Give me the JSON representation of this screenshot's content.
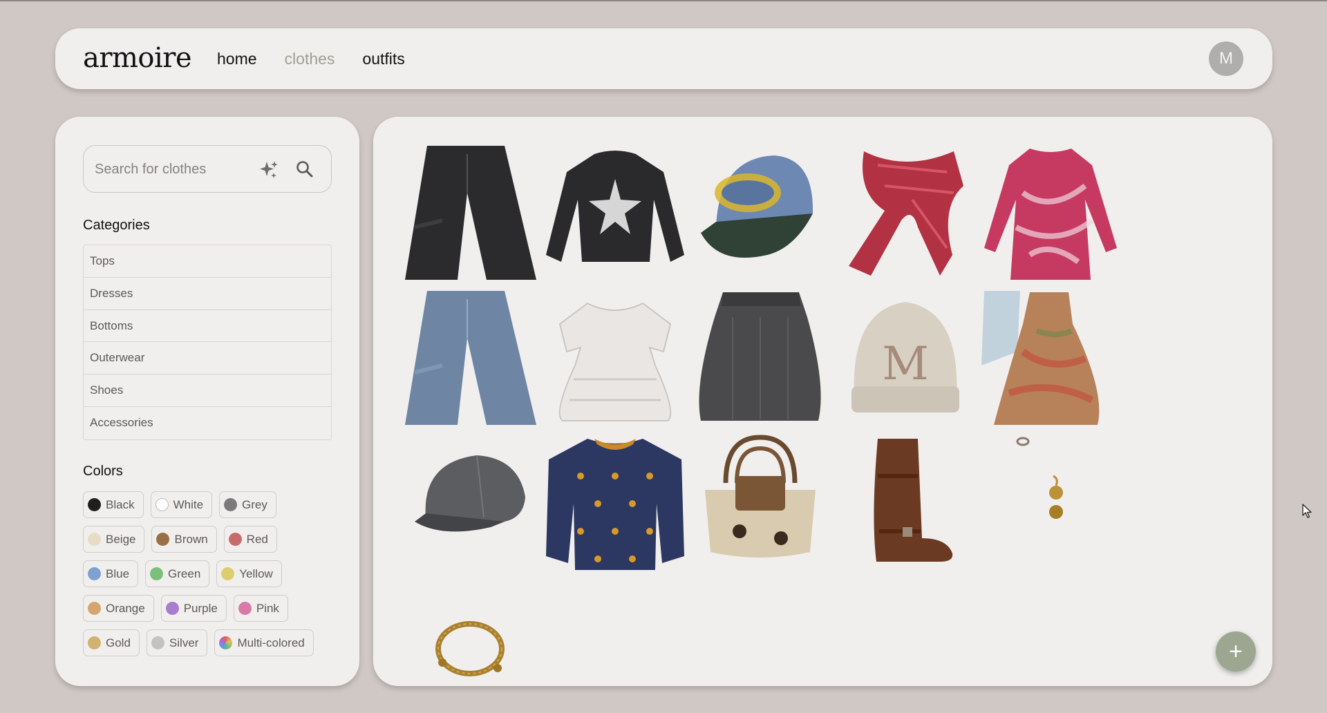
{
  "app": {
    "name": "armoire"
  },
  "nav": {
    "items": [
      "home",
      "clothes",
      "outfits"
    ],
    "active": "clothes"
  },
  "user": {
    "avatar_initial": "M"
  },
  "search": {
    "placeholder": "Search for clothes",
    "value": ""
  },
  "sidebar": {
    "categories_title": "Categories",
    "categories": [
      "Tops",
      "Dresses",
      "Bottoms",
      "Outerwear",
      "Shoes",
      "Accessories"
    ],
    "colors_title": "Colors",
    "colors": [
      {
        "label": "Black",
        "hex": "#1f1f1f"
      },
      {
        "label": "White",
        "hex": "#ffffff"
      },
      {
        "label": "Grey",
        "hex": "#7b7b7b"
      },
      {
        "label": "Beige",
        "hex": "#e9dcc4"
      },
      {
        "label": "Brown",
        "hex": "#9a6f45"
      },
      {
        "label": "Red",
        "hex": "#c96b6b"
      },
      {
        "label": "Blue",
        "hex": "#7ea1d1"
      },
      {
        "label": "Green",
        "hex": "#7bc07a"
      },
      {
        "label": "Yellow",
        "hex": "#dccd6f"
      },
      {
        "label": "Orange",
        "hex": "#d6a56f"
      },
      {
        "label": "Purple",
        "hex": "#a87ccf"
      },
      {
        "label": "Pink",
        "hex": "#d97aa6"
      },
      {
        "label": "Gold",
        "hex": "#d2b270"
      },
      {
        "label": "Silver",
        "hex": "#c2c2c2"
      },
      {
        "label": "Multi-colored",
        "hex": "multi"
      }
    ]
  },
  "items": [
    {
      "name": "black-jeans",
      "type": "jeans",
      "color": "#2b2b2d"
    },
    {
      "name": "black-star-top",
      "type": "longsleeve",
      "color": "#2a2a2c"
    },
    {
      "name": "denim-cap",
      "type": "cap",
      "color": "#6d89b3"
    },
    {
      "name": "red-plaid-scarf",
      "type": "scarf",
      "color": "#b23142"
    },
    {
      "name": "pink-print-dress",
      "type": "dress",
      "color": "#c63a62"
    },
    {
      "name": "blue-jeans",
      "type": "jeans",
      "color": "#6f85a4"
    },
    {
      "name": "white-babydoll-top",
      "type": "babydoll",
      "color": "#e9e6e4"
    },
    {
      "name": "gingham-skirt",
      "type": "skirt",
      "color": "#4a4a4c"
    },
    {
      "name": "beige-beanie",
      "type": "beanie",
      "color": "#d9d0c4"
    },
    {
      "name": "floral-maxi-dress",
      "type": "maxi",
      "color": "#b7815a"
    },
    {
      "name": "grey-newsboy-cap",
      "type": "newsboy",
      "color": "#5c5d60"
    },
    {
      "name": "navy-pattern-sweater",
      "type": "sweater",
      "color": "#2d3862"
    },
    {
      "name": "printed-handbag",
      "type": "bag",
      "color": "#d8cbb0"
    },
    {
      "name": "brown-riding-boot",
      "type": "boot",
      "color": "#6b3a22"
    },
    {
      "name": "gold-earrings",
      "type": "earrings",
      "color": "#b9923a"
    },
    {
      "name": "gold-bangle",
      "type": "bangle",
      "color": "#a9802e"
    }
  ],
  "fab": {
    "label": "+"
  }
}
